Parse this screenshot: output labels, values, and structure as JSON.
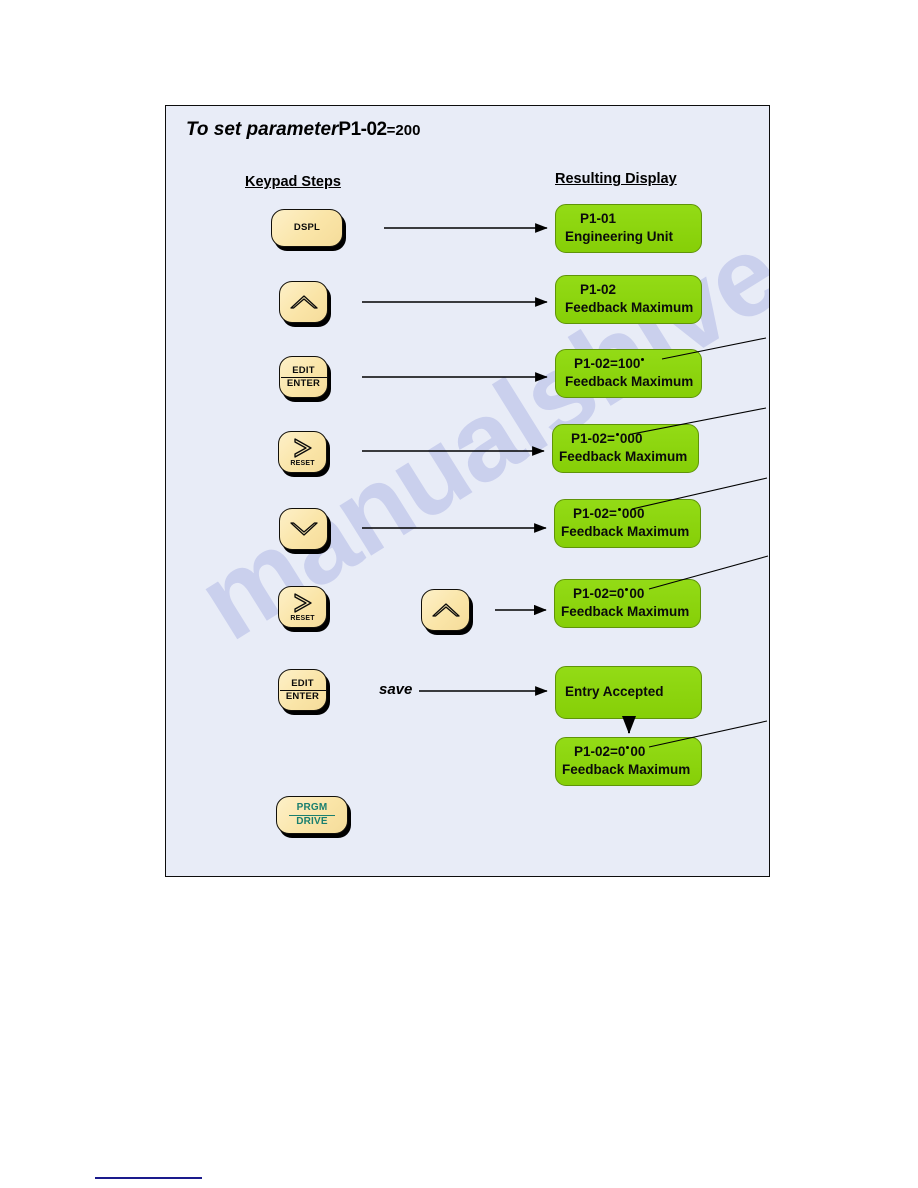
{
  "figure": {
    "title": {
      "lead": "To set  parameter",
      "parameter": "P1-02",
      "equals": "=",
      "value": "200"
    },
    "headers": {
      "keypad": "Keypad Steps",
      "display": "Resulting Display"
    },
    "annotations": {
      "save": "save"
    },
    "colors": {
      "panel_background": "#e8ecf7",
      "panel_border": "#0d0d0d",
      "key_face": "#fae8b0",
      "key_text": "#0b0b0b",
      "key_text_alt": "#1a7f6f",
      "display_green": "#8cd60c",
      "display_text": "#0b0b0b",
      "watermark": "#b9bfe8",
      "footer_rule": "#1a1a8c"
    },
    "watermark_text": "manualshive.com",
    "steps": [
      {
        "key": {
          "name": "dspl-key",
          "type": "wide",
          "icon": "none",
          "labels": [
            "DSPL"
          ]
        },
        "display": {
          "line1": "P1-01",
          "line2": "Engineering Unit"
        }
      },
      {
        "key": {
          "name": "up-arrow-key",
          "type": "square",
          "icon": "chevron-up-icon",
          "labels": []
        },
        "display": {
          "line1": "P1-02",
          "line2": "Feedback Maximum"
        }
      },
      {
        "key": {
          "name": "edit-enter-key",
          "type": "square",
          "icon": "none",
          "labels": [
            "EDIT",
            "ENTER"
          ]
        },
        "display": {
          "line1": "P1-02=100",
          "line2": "Feedback Maximum",
          "cursor": "after"
        }
      },
      {
        "key": {
          "name": "reset-right-key",
          "type": "square",
          "icon": "chevron-right-icon",
          "labels": [
            "RESET"
          ]
        },
        "display": {
          "line1": "P1-02= 000",
          "line2": "Feedback Maximum",
          "cursor": "before-digits"
        }
      },
      {
        "key": {
          "name": "down-arrow-key",
          "type": "square",
          "icon": "chevron-down-icon",
          "labels": []
        },
        "display": {
          "line1": "P1-02= 000",
          "line2": "Feedback Maximum",
          "cursor": "before-digits"
        }
      },
      {
        "key": {
          "name": "reset-right-key",
          "type": "square",
          "icon": "chevron-right-icon",
          "labels": [
            "RESET"
          ]
        },
        "key2": {
          "name": "up-arrow-key",
          "type": "square",
          "icon": "chevron-up-icon",
          "labels": []
        },
        "display": {
          "line1": "P1-02=0 00",
          "line2": "Feedback Maximum",
          "cursor": "mid"
        }
      },
      {
        "key": {
          "name": "edit-enter-key",
          "type": "square",
          "icon": "none",
          "labels": [
            "EDIT",
            "ENTER"
          ]
        },
        "display": {
          "line1": "Entry Accepted",
          "line2": ""
        }
      }
    ],
    "final_display": {
      "line1": "P1-02=0 00",
      "line2": "Feedback Maximum",
      "cursor": "mid"
    },
    "last_key": {
      "name": "prgm-drive-key",
      "type": "wide",
      "labels": [
        "PRGM",
        "DRIVE"
      ]
    }
  }
}
